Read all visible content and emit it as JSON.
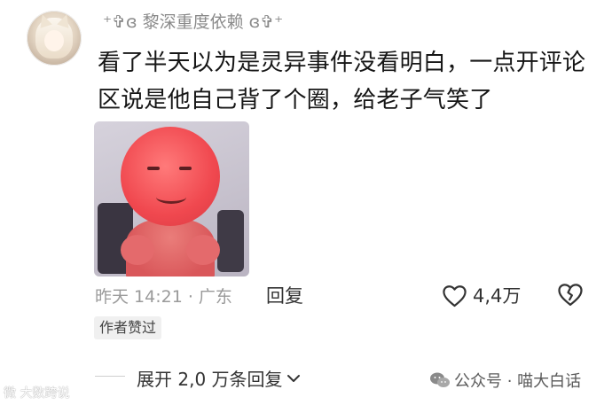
{
  "comment": {
    "username": "⁺✞ɞ 黎深重度依赖 ɞ✞⁺",
    "text_line1": "看了半天以为是灵异事件没看明白，一点开评论",
    "text_line2": "区说是他自己背了个圈，给老子气笑了",
    "timestamp": "昨天 14:21 · 广东",
    "reply_label": "回复",
    "like_count": "4,4万",
    "author_badge": "作者赞过",
    "expand_label": "展开 2,0 万条回复"
  },
  "watermark": {
    "left": "微 大数跨说",
    "right": "公众号 · 喵大白话"
  },
  "icons": {
    "like": "heart-outline-icon",
    "dislike": "broken-heart-icon",
    "expand": "chevron-down-icon",
    "wechat": "wechat-icon"
  },
  "colors": {
    "meta": "#9a9a9a",
    "text": "#161616",
    "sticker_face": "#f0484f"
  }
}
